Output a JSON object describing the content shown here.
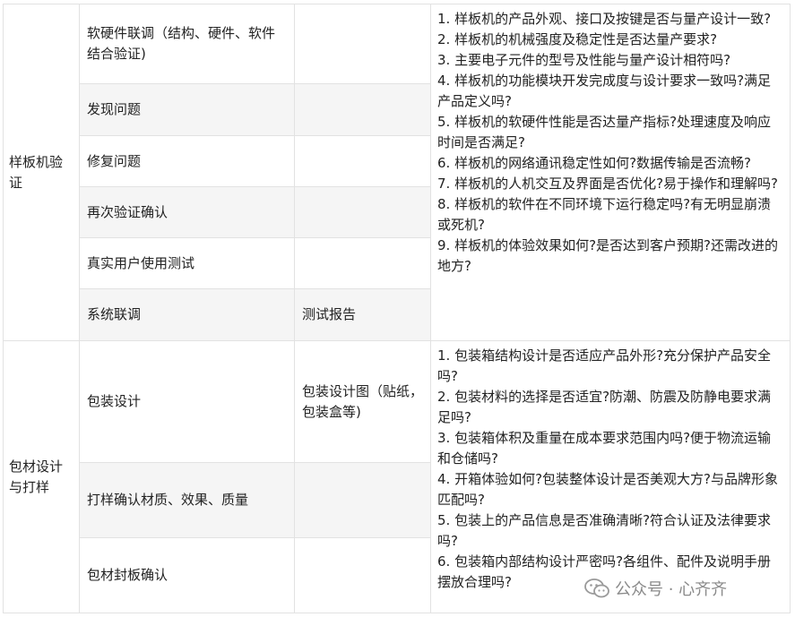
{
  "sections": [
    {
      "stage": "样板机验证",
      "rows": [
        {
          "task": "软硬件联调（结构、硬件、软件结合验证)",
          "deliverable": ""
        },
        {
          "task": "发现问题",
          "deliverable": ""
        },
        {
          "task": "修复问题",
          "deliverable": ""
        },
        {
          "task": "再次验证确认",
          "deliverable": ""
        },
        {
          "task": "真实用户使用测试",
          "deliverable": ""
        },
        {
          "task": "系统联调",
          "deliverable": "测试报告"
        }
      ],
      "checks": [
        "1. 样板机的产品外观、接口及按键是否与量产设计一致?",
        "2. 样板机的机械强度及稳定性是否达量产要求?",
        "3. 主要电子元件的型号及性能与量产设计相符吗?",
        " 4. 样板机的功能模块开发完成度与设计要求一致吗?满足产品定义吗?",
        "5. 样板机的软硬件性能是否达量产指标?处理速度及响应时间是否满足?",
        "6. 样板机的网络通讯稳定性如何?数据传输是否流畅?",
        "7. 样板机的人机交互及界面是否优化?易于操作和理解吗?",
        "8. 样板机的软件在不同环境下运行稳定吗?有无明显崩溃或死机?",
        "9. 样板机的体验效果如何?是否达到客户预期?还需改进的地方?"
      ]
    },
    {
      "stage": "包材设计与打样",
      "rows": [
        {
          "task": "包装设计",
          "deliverable": "包装设计图（贴纸，包装盒等)"
        },
        {
          "task": "打样确认材质、效果、质量",
          "deliverable": ""
        },
        {
          "task": "包材封板确认",
          "deliverable": ""
        }
      ],
      "checks": [
        "1. 包装箱结构设计是否适应产品外形?充分保护产品安全吗?",
        "2. 包装材料的选择是否适宜?防潮、防震及防静电要求满足吗?",
        "3. 包装箱体积及重量在成本要求范围内吗?便于物流运输和仓储吗?",
        "4. 开箱体验如何?包装整体设计是否美观大方?与品牌形象匹配吗?",
        "5. 包装上的产品信息是否准确清晰?符合认证及法律要求吗?",
        "6. 包装箱内部结构设计严密吗?各组件、配件及说明手册摆放合理吗?"
      ]
    }
  ],
  "watermark": {
    "text": "公众号 · 心齐齐",
    "icon": "wechat-icon"
  }
}
